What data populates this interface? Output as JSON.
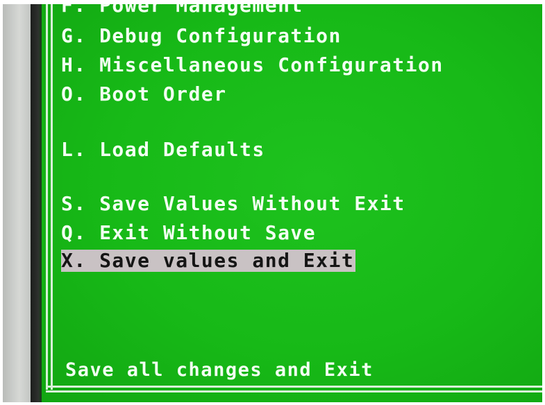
{
  "menu": {
    "items": [
      {
        "key": "F",
        "label": "F. Power Management"
      },
      {
        "key": "G",
        "label": "G. Debug Configuration"
      },
      {
        "key": "H",
        "label": "H. Miscellaneous Configuration"
      },
      {
        "key": "O",
        "label": "O. Boot Order"
      },
      {
        "key": "L",
        "label": "L. Load Defaults"
      },
      {
        "key": "S",
        "label": "S. Save Values Without Exit"
      },
      {
        "key": "Q",
        "label": "Q. Exit Without Save"
      },
      {
        "key": "X",
        "label": "X. Save values and Exit"
      }
    ],
    "selected_key": "X"
  },
  "status": {
    "text": "Save all changes and Exit"
  },
  "colors": {
    "screen_background": "#17b917",
    "text": "#f2fff2",
    "highlight_background": "#c9c2c4",
    "highlight_text": "#151515"
  }
}
